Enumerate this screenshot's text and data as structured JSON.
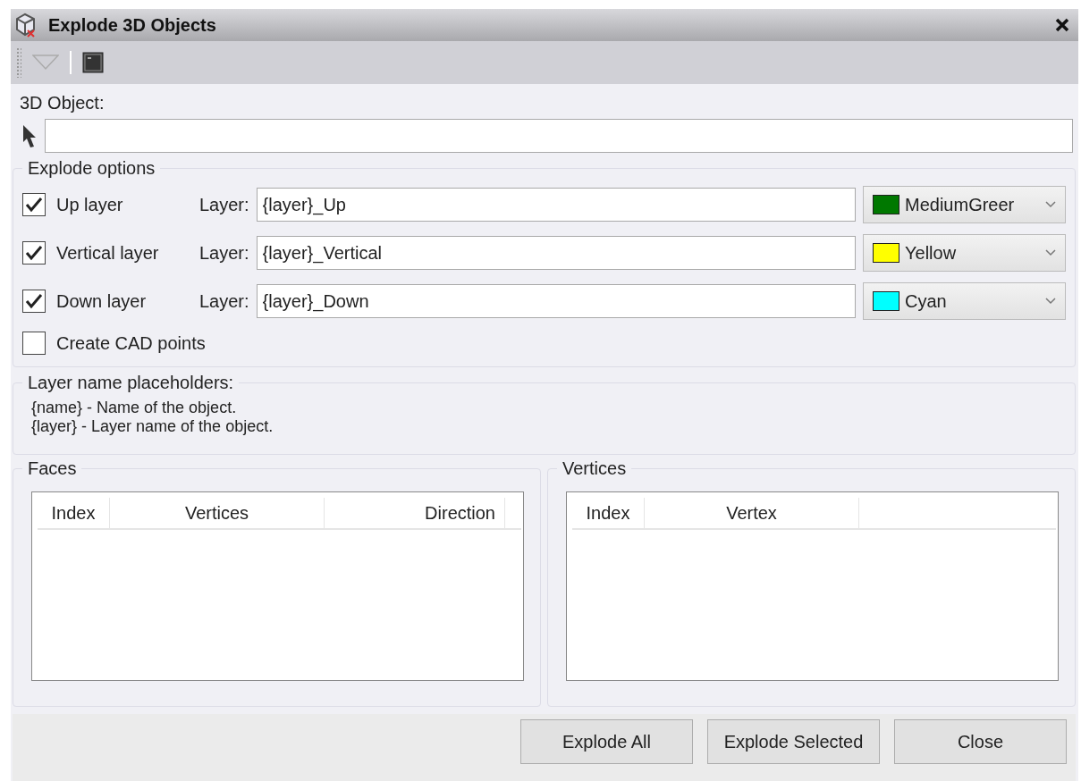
{
  "window": {
    "title": "Explode 3D Objects"
  },
  "object_field": {
    "label": "3D Object:"
  },
  "explode_options": {
    "title": "Explode options",
    "rows": [
      {
        "label": "Up layer",
        "checked": true,
        "layer_label": "Layer:",
        "layer": "{layer}_Up",
        "color_name": "MediumGreer",
        "color": "#007800"
      },
      {
        "label": "Vertical layer",
        "checked": true,
        "layer_label": "Layer:",
        "layer": "{layer}_Vertical",
        "color_name": "Yellow",
        "color": "#ffff00"
      },
      {
        "label": "Down layer",
        "checked": true,
        "layer_label": "Layer:",
        "layer": "{layer}_Down",
        "color_name": "Cyan",
        "color": "#00ffff"
      }
    ],
    "cad_points": {
      "label": "Create CAD points",
      "checked": false
    }
  },
  "placeholders": {
    "title": "Layer name placeholders:",
    "lines": [
      "{name} - Name of the object.",
      "{layer} - Layer name of the object."
    ]
  },
  "faces": {
    "title": "Faces",
    "columns": [
      "Index",
      "Vertices",
      "Direction"
    ]
  },
  "vertices": {
    "title": "Vertices",
    "columns": [
      "Index",
      "Vertex"
    ]
  },
  "buttons": [
    "Explode All",
    "Explode Selected",
    "Close"
  ]
}
